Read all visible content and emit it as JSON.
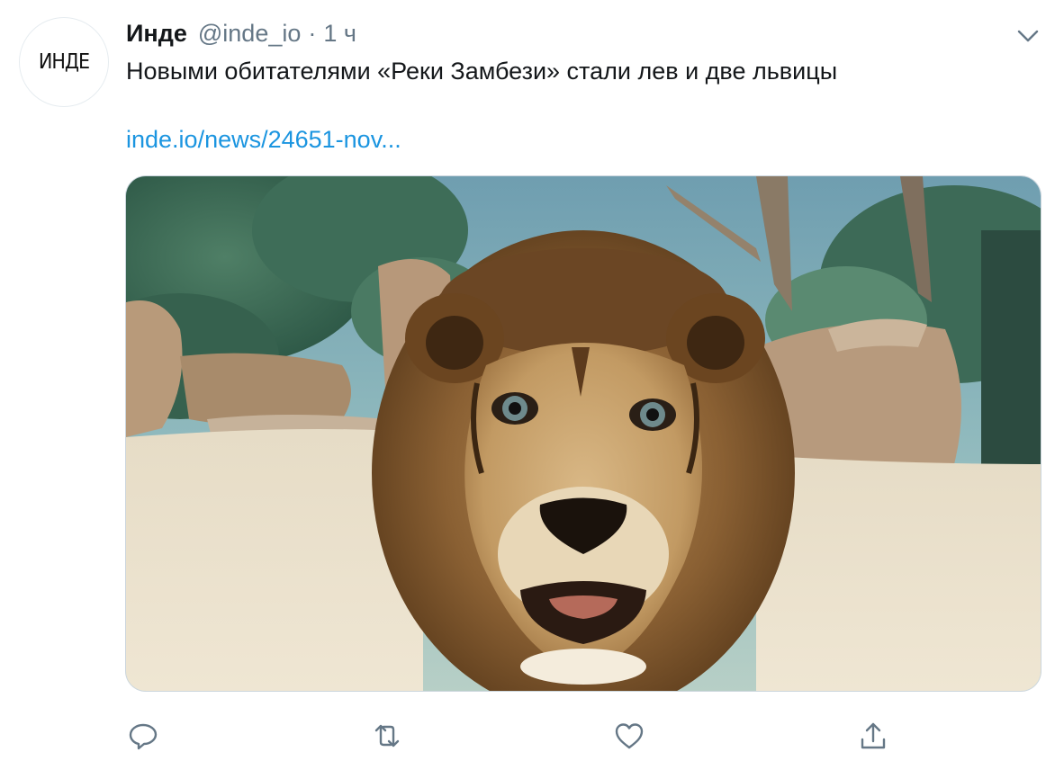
{
  "tweet": {
    "avatar_logo": "ИНДЕ",
    "author_name": "Инде",
    "author_handle": "@inde_io",
    "separator": "·",
    "time": "1 ч",
    "text": "Новыми обитателями «Реки Замбези» стали лев и две львицы",
    "link": "inde.io/news/24651-nov..."
  },
  "icons": {
    "menu": "chevron-down-icon",
    "reply": "reply-icon",
    "retweet": "retweet-icon",
    "like": "heart-icon",
    "share": "share-icon"
  },
  "colors": {
    "text": "#14171a",
    "secondary": "#657786",
    "link": "#1b95e0",
    "icon": "#657786"
  }
}
